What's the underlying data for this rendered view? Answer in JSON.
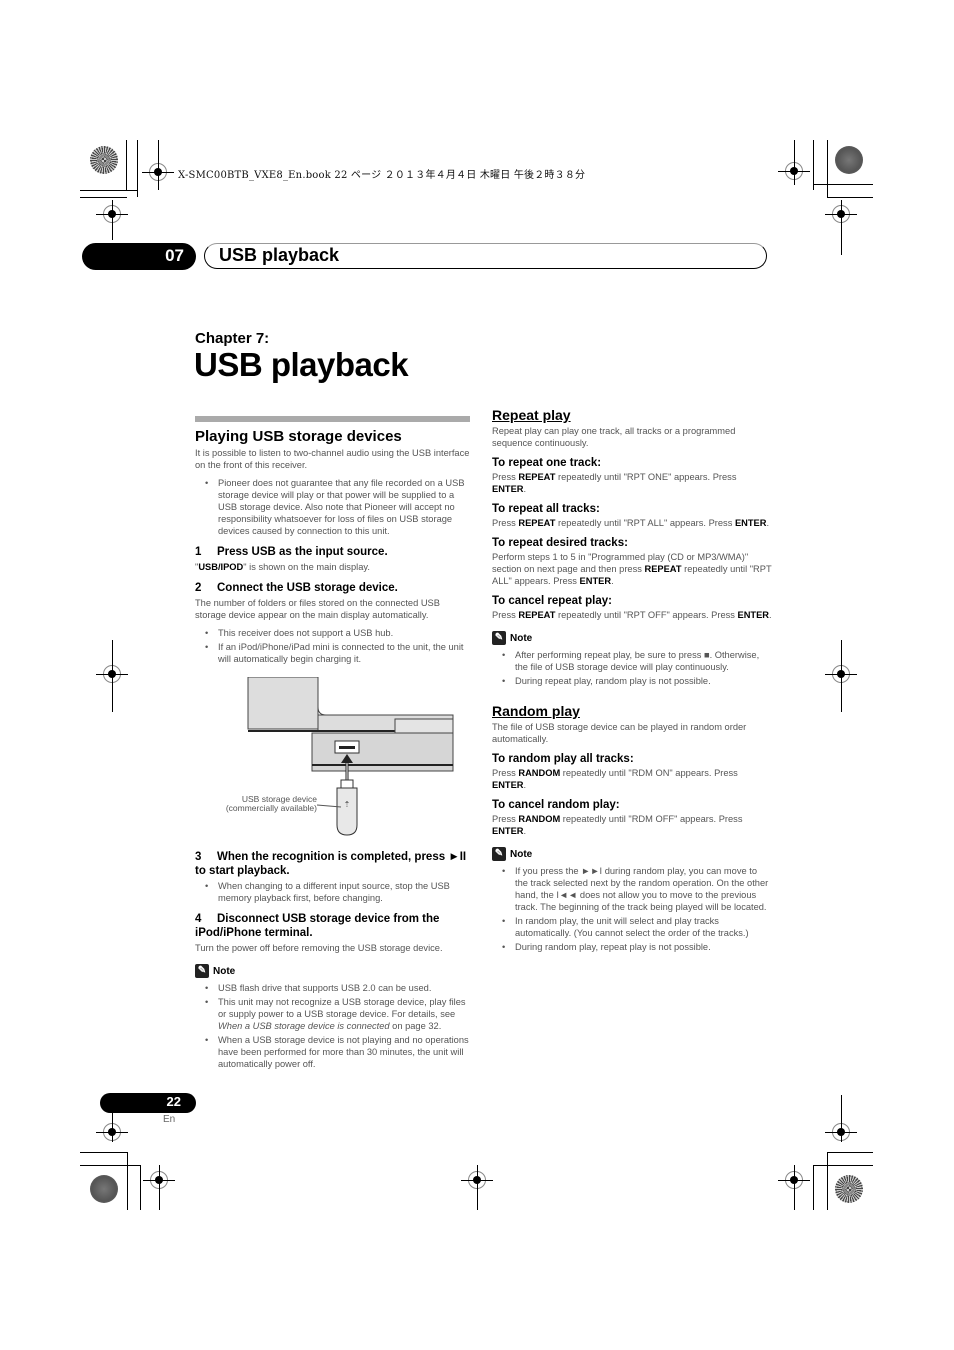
{
  "slug": "X-SMC00BTB_VXE8_En.book  22 ページ  ２０１３年４月４日  木曜日  午後２時３８分",
  "header": {
    "chapter_number": "07",
    "title": "USB playback"
  },
  "chapter": {
    "label": "Chapter 7:",
    "title": "USB playback"
  },
  "left": {
    "section_title": "Playing USB storage devices",
    "intro": "It is possible to listen to two-channel audio using the USB interface on the front of this receiver.",
    "intro_bullets": [
      "Pioneer does not guarantee that any file recorded on a USB storage device will play or that power will be supplied to a USB storage device. Also note that Pioneer will accept no responsibility whatsoever for loss of files on USB storage devices caused by connection to this unit."
    ],
    "steps": [
      {
        "num": "1",
        "title": "Press USB as the input source.",
        "text_pre": "\"",
        "text_bold": "USB/IPOD",
        "text_post": "\" is shown on the main display."
      },
      {
        "num": "2",
        "title": "Connect the USB storage device.",
        "text": "The number of folders or files stored on the connected USB storage device appear on the main display automatically.",
        "bullets": [
          "This receiver does not support a USB hub.",
          "If an iPod/iPhone/iPad mini is connected to the unit, the unit will automatically begin charging it."
        ]
      },
      {
        "num": "3",
        "title": "When the recognition is completed, press ►II to start playback.",
        "bullets": [
          "When changing to a different input source, stop the USB memory playback first, before changing."
        ]
      },
      {
        "num": "4",
        "title": "Disconnect USB storage device from the iPod/iPhone terminal.",
        "text": "Turn the power off before removing the USB storage device."
      }
    ],
    "illustration": {
      "caption_line1": "USB storage device",
      "caption_line2": "(commercially available)"
    },
    "note": {
      "label": "Note",
      "bullets": [
        "USB flash drive that supports USB 2.0 can be used.",
        "This unit may not recognize a USB storage device, play files or supply power to a USB storage device. For details, see ",
        "When a USB storage device is not playing and no operations have been performed for more than 30 minutes, the unit will automatically power off."
      ],
      "link_text": "When a USB storage device is connected",
      "link_suffix": " on page 32."
    }
  },
  "right": {
    "repeat": {
      "title": "Repeat play",
      "intro": "Repeat play can play one track, all tracks or a programmed sequence continuously.",
      "items": [
        {
          "title": "To repeat one track:",
          "pre": "Press ",
          "key": "REPEAT",
          "mid": " repeatedly until \"RPT ONE\" appears. Press ",
          "key2": "ENTER",
          "post": "."
        },
        {
          "title": "To repeat all tracks:",
          "pre": "Press ",
          "key": "REPEAT",
          "mid": " repeatedly until \"RPT ALL\" appears. Press ",
          "key2": "ENTER",
          "post": "."
        },
        {
          "title": "To repeat desired tracks:",
          "pre": "Perform steps 1 to 5 in \"Programmed play (CD or MP3/WMA)\" section on next page and then press ",
          "key": "REPEAT",
          "mid": " repeatedly until \"RPT ALL\" appears. Press ",
          "key2": "ENTER",
          "post": "."
        },
        {
          "title": "To cancel repeat play:",
          "pre": "Press ",
          "key": "REPEAT",
          "mid": " repeatedly until \"RPT OFF\" appears. Press ",
          "key2": "ENTER",
          "post": "."
        }
      ],
      "note": {
        "label": "Note",
        "bullets": [
          "After performing repeat play, be sure to press ■. Otherwise, the file of USB storage device will play continuously.",
          "During repeat play, random play is not possible."
        ]
      }
    },
    "random": {
      "title": "Random play",
      "intro": "The file of USB storage device can be played in random order automatically.",
      "items": [
        {
          "title": "To random play all tracks:",
          "pre": "Press ",
          "key": "RANDOM",
          "mid": " repeatedly until \"RDM ON\" appears. Press ",
          "key2": "ENTER",
          "post": "."
        },
        {
          "title": "To cancel random play:",
          "pre": "Press ",
          "key": "RANDOM",
          "mid": " repeatedly until \"RDM OFF\" appears. Press ",
          "key2": "ENTER",
          "post": "."
        }
      ],
      "note": {
        "label": "Note",
        "bullets": [
          "If you press the ►►I during random play, you can move to the track selected next by the random operation. On the other hand, the I◄◄ does not allow you to move to the previous track. The beginning of the track being played will be located.",
          "In random play, the unit will select and play tracks automatically. (You cannot select the order of the tracks.)",
          "During random play, repeat play is not possible."
        ]
      }
    }
  },
  "footer": {
    "page_number": "22",
    "language": "En"
  }
}
